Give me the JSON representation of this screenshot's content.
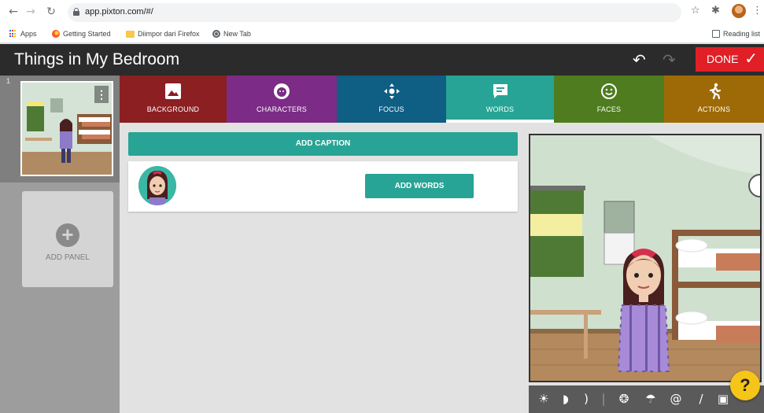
{
  "browser": {
    "url": "app.pixton.com/#/",
    "bookmarks": [
      "Apps",
      "Getting Started",
      "Diimpor dari Firefox",
      "New Tab"
    ],
    "reading_list": "Reading list"
  },
  "app": {
    "title": "Things in My Bedroom",
    "done_label": "DONE"
  },
  "panels": {
    "current_number": "1",
    "add_label": "ADD PANEL"
  },
  "tabs": [
    {
      "label": "BACKGROUND",
      "color": "#8b1f22",
      "icon": "image-icon"
    },
    {
      "label": "CHARACTERS",
      "color": "#7c2b86",
      "icon": "face-icon"
    },
    {
      "label": "FOCUS",
      "color": "#0f5e84",
      "icon": "move-icon"
    },
    {
      "label": "WORDS",
      "color": "#27a495",
      "icon": "speech-bubble-icon",
      "active": true
    },
    {
      "label": "FACES",
      "color": "#4e7c1f",
      "icon": "smiley-icon"
    },
    {
      "label": "ACTIONS",
      "color": "#9e6a07",
      "icon": "running-person-icon"
    }
  ],
  "words": {
    "add_caption_label": "ADD CAPTION",
    "add_words_label": "ADD WORDS"
  },
  "toolbar_icons": [
    "brightness-icon",
    "moon-icon",
    "crescent-icon",
    "effect-icon",
    "rain-icon",
    "swirl-icon",
    "brush-icon",
    "save-icon"
  ],
  "help_label": "?",
  "colors": {
    "accent": "#27a495",
    "done": "#e11f26",
    "header": "#2b2b2b",
    "help": "#f5c518"
  }
}
